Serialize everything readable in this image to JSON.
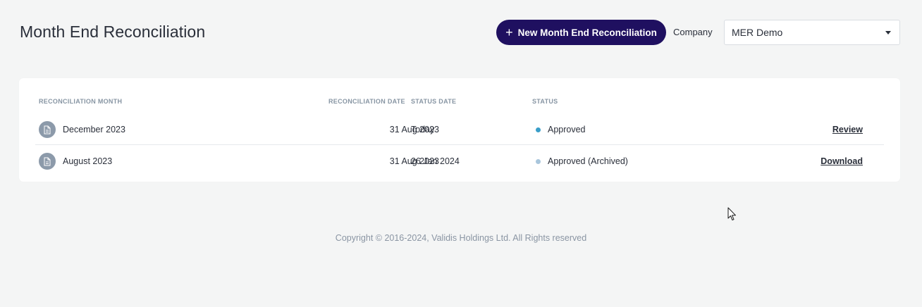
{
  "page": {
    "title": "Month End Reconciliation"
  },
  "toolbar": {
    "new_button_label": "New Month End Reconciliation",
    "new_button_icon": "plus-icon",
    "company_label": "Company",
    "company_selected": "MER Demo"
  },
  "table": {
    "columns": {
      "month": "RECONCILIATION MONTH",
      "rec_date": "RECONCILIATION DATE",
      "status_date": "STATUS DATE",
      "status": "STATUS"
    },
    "rows": [
      {
        "month": "December 2023",
        "rec_date": "31 Aug 2023",
        "status_date": "Today",
        "status": "Approved",
        "status_color": "#3a9ec9",
        "action": "Review"
      },
      {
        "month": "August 2023",
        "rec_date": "31 Aug 2023",
        "status_date": "26 Jan 2024",
        "status": "Approved (Archived)",
        "status_color": "#a9c6dc",
        "action": "Download"
      }
    ]
  },
  "footer": {
    "copyright": "Copyright © 2016-2024, Validis Holdings Ltd. All Rights reserved"
  },
  "colors": {
    "primary": "#1f1060",
    "background": "#f4f5f5",
    "icon_bg": "#8c9aaa"
  }
}
